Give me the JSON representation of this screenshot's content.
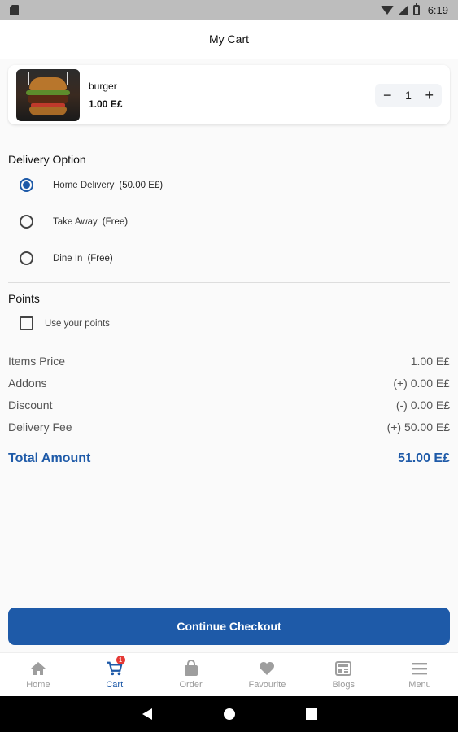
{
  "status_bar": {
    "time": "6:19"
  },
  "app_bar": {
    "title": "My Cart"
  },
  "cart_item": {
    "name": "burger",
    "price": "1.00 E£",
    "quantity": "1",
    "decrement_label": "−",
    "increment_label": "+"
  },
  "delivery": {
    "title": "Delivery Option",
    "options": [
      {
        "label": "Home Delivery",
        "extra": "(50.00 E£)",
        "selected": true
      },
      {
        "label": "Take Away",
        "extra": "(Free)",
        "selected": false
      },
      {
        "label": "Dine In",
        "extra": "(Free)",
        "selected": false
      }
    ]
  },
  "points": {
    "title": "Points",
    "checkbox_label": "Use your points"
  },
  "summary": {
    "rows": [
      {
        "label": "Items Price",
        "value": "1.00 E£"
      },
      {
        "label": "Addons",
        "value": "(+) 0.00 E£"
      },
      {
        "label": "Discount",
        "value": "(-) 0.00 E£"
      },
      {
        "label": "Delivery Fee",
        "value": "(+) 50.00 E£"
      }
    ],
    "total_label": "Total Amount",
    "total_value": "51.00 E£"
  },
  "checkout": {
    "label": "Continue Checkout"
  },
  "bottom_nav": {
    "items": [
      {
        "label": "Home",
        "icon": "home-icon"
      },
      {
        "label": "Cart",
        "icon": "cart-icon",
        "badge": "1"
      },
      {
        "label": "Order",
        "icon": "bag-icon"
      },
      {
        "label": "Favourite",
        "icon": "heart-icon"
      },
      {
        "label": "Blogs",
        "icon": "blogs-icon"
      },
      {
        "label": "Menu",
        "icon": "menu-icon"
      }
    ]
  },
  "colors": {
    "primary": "#1e5aa8",
    "badge": "#e53935"
  }
}
